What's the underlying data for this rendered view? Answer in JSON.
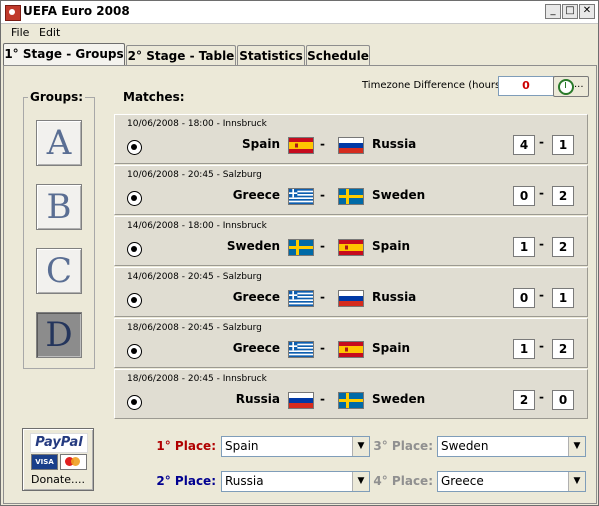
{
  "window": {
    "title": "UEFA Euro 2008",
    "min_glyph": "_",
    "max_glyph": "□",
    "close_glyph": "✕"
  },
  "menu": [
    {
      "label": "File"
    },
    {
      "label": "Edit"
    }
  ],
  "tabs": [
    {
      "label": "1° Stage - Groups",
      "active": true
    },
    {
      "label": "2° Stage - Table"
    },
    {
      "label": "Statistics"
    },
    {
      "label": "Schedule"
    }
  ],
  "groups": {
    "title": "Groups:",
    "items": [
      {
        "label": "A"
      },
      {
        "label": "B"
      },
      {
        "label": "C"
      },
      {
        "label": "D",
        "selected": true
      }
    ]
  },
  "matches_title": "Matches:",
  "timezone": {
    "label": "Timezone Difference (hours):",
    "value": "0",
    "button_text": "..."
  },
  "matches": [
    {
      "date": "10/06/2008 - 18:00 - Innsbruck",
      "home": "Spain",
      "away": "Russia",
      "home_score": "4",
      "away_score": "1",
      "home_flag": "spain",
      "away_flag": "russia"
    },
    {
      "date": "10/06/2008 - 20:45 - Salzburg",
      "home": "Greece",
      "away": "Sweden",
      "home_score": "0",
      "away_score": "2",
      "home_flag": "greece",
      "away_flag": "sweden"
    },
    {
      "date": "14/06/2008 - 18:00 - Innsbruck",
      "home": "Sweden",
      "away": "Spain",
      "home_score": "1",
      "away_score": "2",
      "home_flag": "sweden",
      "away_flag": "spain"
    },
    {
      "date": "14/06/2008 - 20:45 - Salzburg",
      "home": "Greece",
      "away": "Russia",
      "home_score": "0",
      "away_score": "1",
      "home_flag": "greece",
      "away_flag": "russia"
    },
    {
      "date": "18/06/2008 - 20:45 - Salzburg",
      "home": "Greece",
      "away": "Spain",
      "home_score": "1",
      "away_score": "2",
      "home_flag": "greece",
      "away_flag": "spain"
    },
    {
      "date": "18/06/2008 - 20:45 - Innsbruck",
      "home": "Russia",
      "away": "Sweden",
      "home_score": "2",
      "away_score": "0",
      "home_flag": "russia",
      "away_flag": "sweden"
    }
  ],
  "match_dash": "-",
  "places": {
    "first": {
      "label": "1° Place:",
      "value": "Spain",
      "color": "#b00000"
    },
    "second": {
      "label": "2° Place:",
      "value": "Russia",
      "color": "#000090"
    },
    "third": {
      "label": "3° Place:",
      "value": "Sweden",
      "color": "#909090"
    },
    "fourth": {
      "label": "4° Place:",
      "value": "Greece",
      "color": "#909090"
    }
  },
  "combo_arrow_glyph": "▼",
  "donate": {
    "logo_text": "PayPal",
    "visa_text": "VISA",
    "label": "Donate...."
  }
}
